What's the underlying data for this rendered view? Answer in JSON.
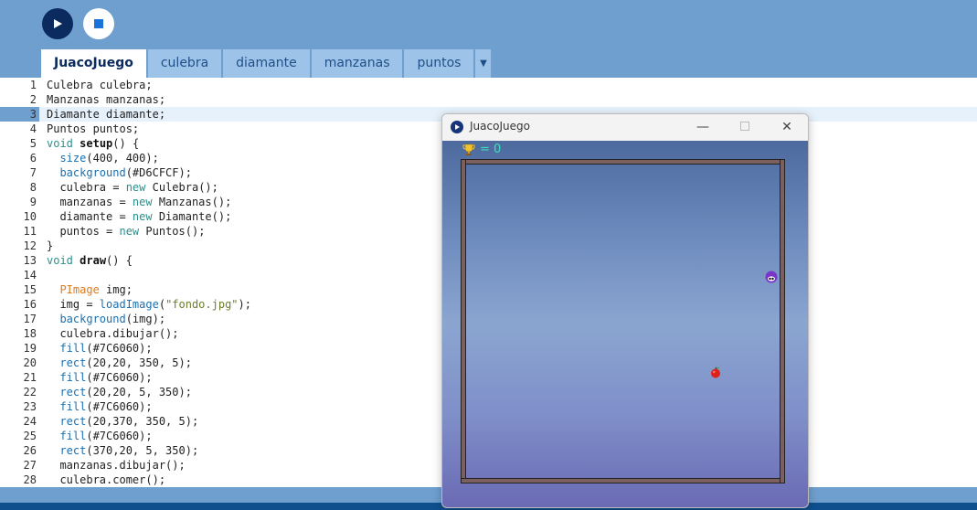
{
  "toolbar": {
    "run_icon": "play-icon",
    "stop_icon": "stop-icon"
  },
  "tabs": [
    {
      "label": "JuacoJuego",
      "active": true
    },
    {
      "label": "culebra",
      "active": false
    },
    {
      "label": "diamante",
      "active": false
    },
    {
      "label": "manzanas",
      "active": false
    },
    {
      "label": "puntos",
      "active": false
    }
  ],
  "tab_more_icon": "chevron-down-icon",
  "editor": {
    "current_line": 3,
    "lines": [
      {
        "n": "1",
        "text": "Culebra culebra;"
      },
      {
        "n": "2",
        "text": "Manzanas manzanas;"
      },
      {
        "n": "3",
        "text": "Diamante diamante;"
      },
      {
        "n": "4",
        "text": "Puntos puntos;"
      },
      {
        "n": "5",
        "text": "void setup() {"
      },
      {
        "n": "6",
        "text": "  size(400, 400);"
      },
      {
        "n": "7",
        "text": "  background(#D6CFCF);"
      },
      {
        "n": "8",
        "text": "  culebra = new Culebra();"
      },
      {
        "n": "9",
        "text": "  manzanas = new Manzanas();"
      },
      {
        "n": "10",
        "text": "  diamante = new Diamante();"
      },
      {
        "n": "11",
        "text": "  puntos = new Puntos();"
      },
      {
        "n": "12",
        "text": "}"
      },
      {
        "n": "13",
        "text": "void draw() {"
      },
      {
        "n": "14",
        "text": ""
      },
      {
        "n": "15",
        "text": "  PImage img;"
      },
      {
        "n": "16",
        "text": "  img = loadImage(\"fondo.jpg\");"
      },
      {
        "n": "17",
        "text": "  background(img);"
      },
      {
        "n": "18",
        "text": "  culebra.dibujar();"
      },
      {
        "n": "19",
        "text": "  fill(#7C6060);"
      },
      {
        "n": "20",
        "text": "  rect(20,20, 350, 5);"
      },
      {
        "n": "21",
        "text": "  fill(#7C6060);"
      },
      {
        "n": "22",
        "text": "  rect(20,20, 5, 350);"
      },
      {
        "n": "23",
        "text": "  fill(#7C6060);"
      },
      {
        "n": "24",
        "text": "  rect(20,370, 350, 5);"
      },
      {
        "n": "25",
        "text": "  fill(#7C6060);"
      },
      {
        "n": "26",
        "text": "  rect(370,20, 5, 350);"
      },
      {
        "n": "27",
        "text": "  manzanas.dibujar();"
      },
      {
        "n": "28",
        "text": "  culebra.comer();"
      }
    ]
  },
  "sketch_window": {
    "title": "JuacoJuego",
    "score_text": "= 0",
    "wall_color": "#7C6060",
    "close_glyph": "✕",
    "minimize_glyph": "—"
  },
  "colors": {
    "accent": "#0b2a5e",
    "toolbar_bg": "#6f9fcf",
    "score_color": "#3fe0b9"
  }
}
